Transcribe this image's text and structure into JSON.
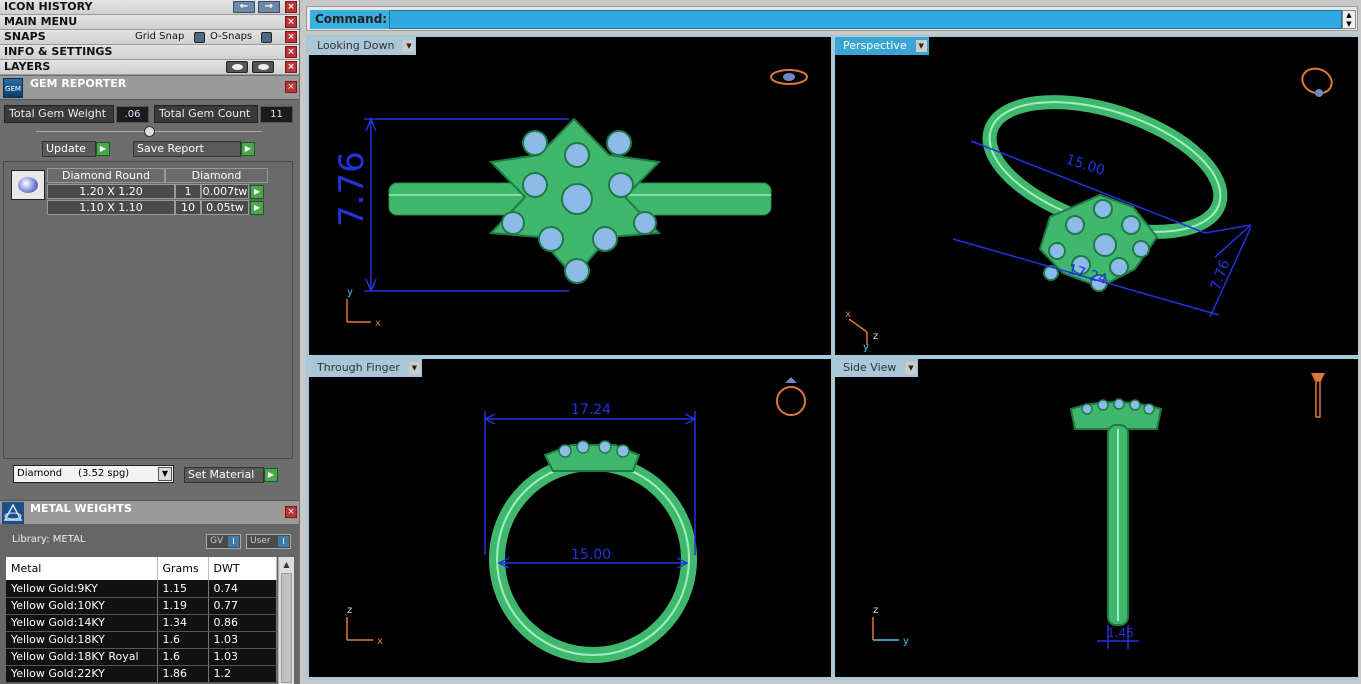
{
  "left_bars": {
    "icon_history": "ICON HISTORY",
    "main_menu": "MAIN MENU",
    "snaps": "SNAPS",
    "grid_snap": "Grid Snap",
    "o_snaps": "O-Snaps",
    "info_settings": "INFO & SETTINGS",
    "layers": "LAYERS"
  },
  "gem_reporter": {
    "title": "GEM REPORTER",
    "total_weight_label": "Total Gem Weight",
    "total_weight_value": ".06",
    "total_count_label": "Total Gem Count",
    "total_count_value": "11",
    "update_label": "Update",
    "save_report_label": "Save Report",
    "columns": [
      "Diamond Round",
      "Diamond"
    ],
    "rows": [
      {
        "size": "1.20 X 1.20",
        "count": "1",
        "weight": "0.007tw"
      },
      {
        "size": "1.10 X 1.10",
        "count": "10",
        "weight": "0.05tw"
      }
    ],
    "material_value": "Diamond     (3.52 spg)",
    "set_material_label": "Set Material"
  },
  "metal_weights": {
    "title": "METAL WEIGHTS",
    "library_label": "Library: METAL",
    "gv_label": "GV",
    "user_label": "User",
    "columns": [
      "Metal",
      "Grams",
      "DWT"
    ],
    "rows": [
      {
        "metal": "Yellow Gold:9KY",
        "grams": "1.15",
        "dwt": "0.74"
      },
      {
        "metal": "Yellow Gold:10KY",
        "grams": "1.19",
        "dwt": "0.77"
      },
      {
        "metal": "Yellow Gold:14KY",
        "grams": "1.34",
        "dwt": "0.86"
      },
      {
        "metal": "Yellow Gold:18KY",
        "grams": "1.6",
        "dwt": "1.03"
      },
      {
        "metal": "Yellow Gold:18KY Royal",
        "grams": "1.6",
        "dwt": "1.03"
      },
      {
        "metal": "Yellow Gold:22KY",
        "grams": "1.86",
        "dwt": "1.2"
      }
    ]
  },
  "command": {
    "label": "Command:",
    "value": ""
  },
  "viewports": {
    "top_left": "Looking Down",
    "top_right": "Perspective",
    "bottom_left": "Through Finger",
    "bottom_right": "Side View"
  },
  "dimensions": {
    "looking_down_height": "7.76",
    "persp_length": "15.00",
    "persp_width": "17.24",
    "persp_height": "7.76",
    "finger_width": "17.24",
    "finger_inner": "15.00",
    "side_width": "1.46"
  },
  "axes": {
    "x": "x",
    "y": "y",
    "z": "z"
  },
  "colors": {
    "tab_active": "#3aa6d6",
    "tab_inactive": "#a9c7d6",
    "ring_green": "#3fb86e",
    "gem_blue": "#7fbde8",
    "dim_blue": "#2233dd",
    "axis_orange": "#e0783c"
  }
}
